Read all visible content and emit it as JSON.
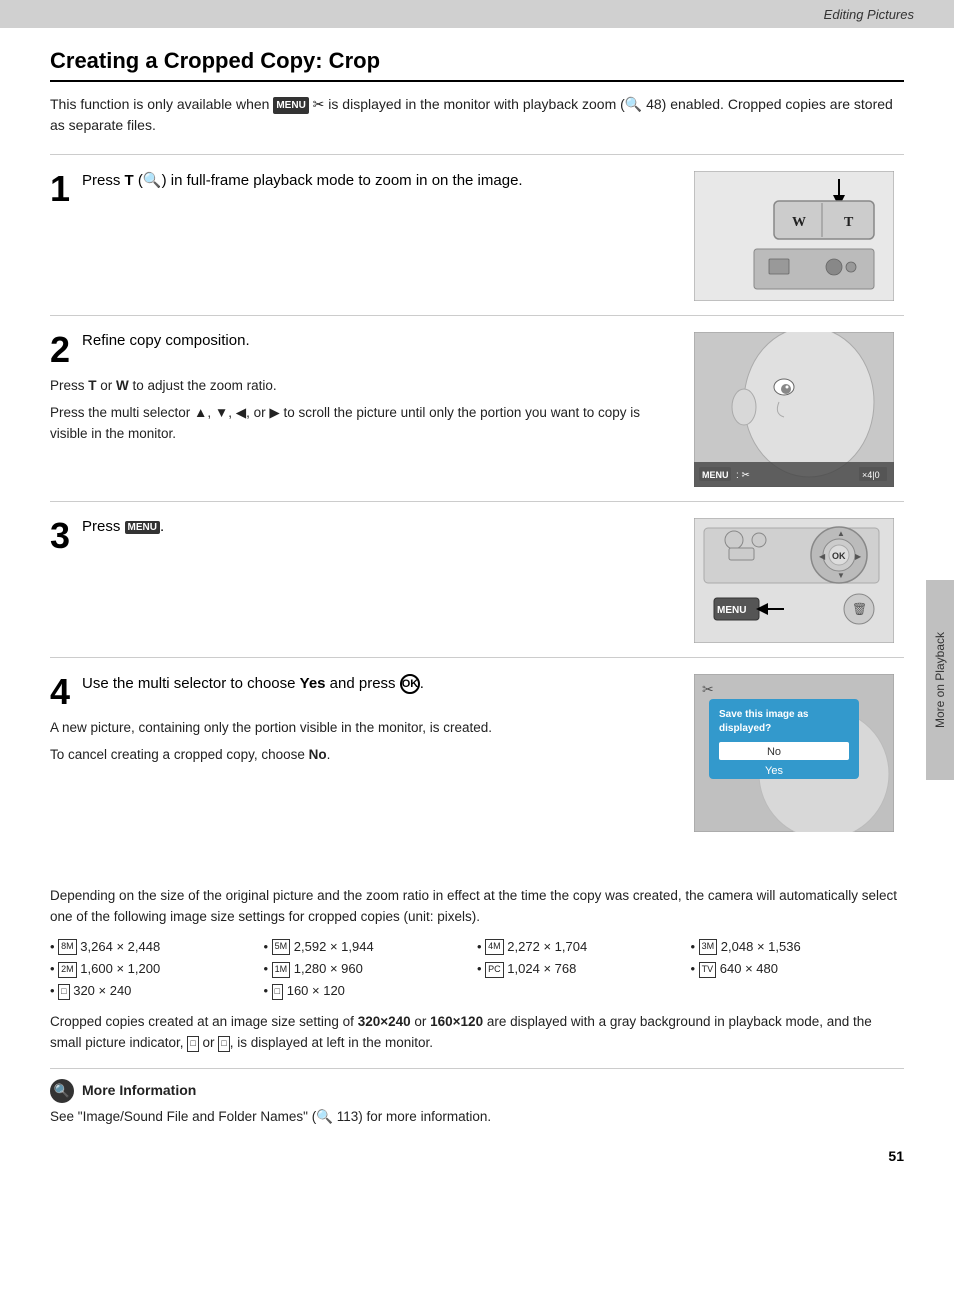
{
  "header": {
    "title": "Editing Pictures"
  },
  "page_title": "Creating a Cropped Copy: Crop",
  "intro": "This function is only available when  is displayed in the monitor with playback zoom ( 48) enabled. Cropped copies are stored as separate files.",
  "steps": [
    {
      "number": "1",
      "heading": "Press T (🔍) in full-frame playback mode to zoom in on the image.",
      "body": []
    },
    {
      "number": "2",
      "heading": "Refine copy composition.",
      "body": [
        "Press T or W to adjust the zoom ratio.",
        "Press the multi selector ▲, ▼, ◀, or ▶ to scroll the picture until only the portion you want to copy is visible in the monitor."
      ]
    },
    {
      "number": "3",
      "heading": "Press MENU.",
      "body": []
    },
    {
      "number": "4",
      "heading": "Use the multi selector to choose Yes and press ⊙.",
      "body": [
        "A new picture, containing only the portion visible in the monitor, is created.",
        "To cancel creating a cropped copy, choose No."
      ]
    }
  ],
  "bottom_text": "Depending on the size of the original picture and the zoom ratio in effect at the time the copy was created, the camera will automatically select one of the following image size settings for cropped copies (unit: pixels).",
  "pixel_sizes": {
    "col1": [
      "3,264 × 2,448",
      "1,600 × 1,200",
      "320 × 240"
    ],
    "col2": [
      "2,592 × 1,944",
      "1,280 × 960",
      "160 × 120"
    ],
    "col3": [
      "2,272 × 1,704",
      "1,024 × 768"
    ],
    "col4": [
      "2,048 × 1,536",
      "640 × 480"
    ]
  },
  "cropped_note": "Cropped copies created at an image size setting of 320×240 or 160×120 are displayed with a gray background in playback mode, and the small picture indicator,  or  , is displayed at left in the monitor.",
  "more_info": {
    "heading": "More Information",
    "text": "See \"Image/Sound File and Folder Names\" ( 113) for more information."
  },
  "page_number": "51",
  "sidebar_label": "More on Playback",
  "icons": {
    "menu_label": "MENU",
    "scissors_label": "✂",
    "search_icon": "🔍",
    "ok_label": "OK",
    "more_info_icon": "🔍"
  },
  "save_dialog": {
    "title": "Save this image as displayed?",
    "no_label": "No",
    "yes_label": "Yes"
  }
}
